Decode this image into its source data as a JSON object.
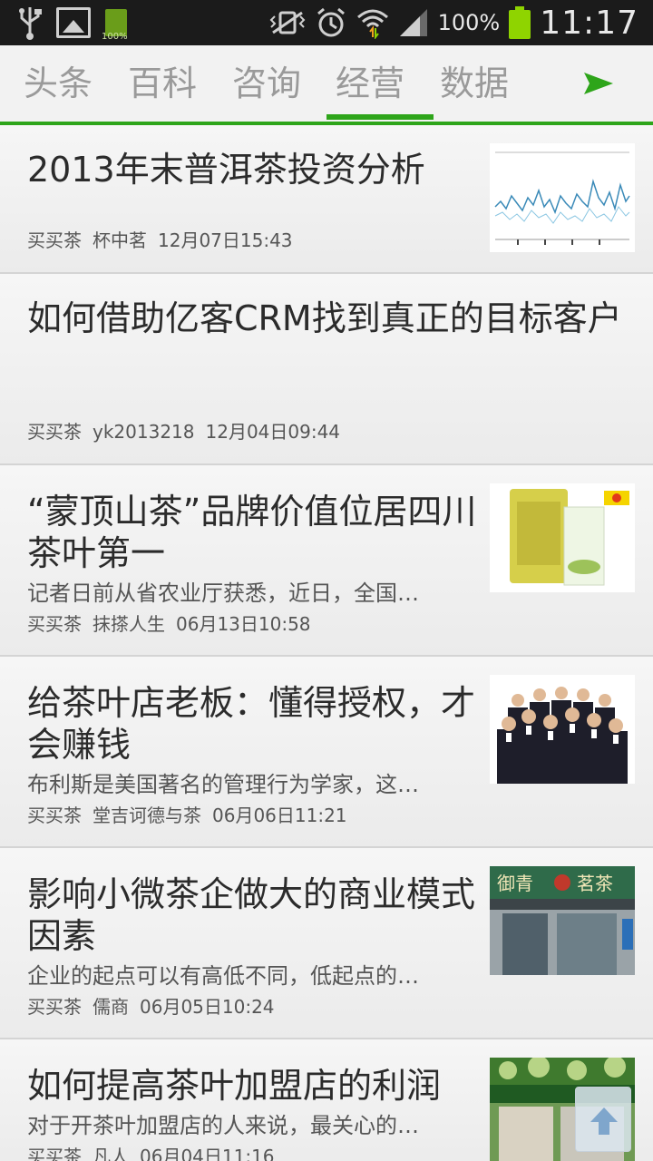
{
  "status_bar": {
    "battery_small_label": "100%",
    "battery_percent": "100%",
    "time": "11:17"
  },
  "tabs": [
    {
      "label": "头条"
    },
    {
      "label": "百科"
    },
    {
      "label": "咨询"
    },
    {
      "label": "经营",
      "active": true
    },
    {
      "label": "数据"
    }
  ],
  "articles": [
    {
      "title": "2013年末普洱茶投资分析",
      "summary": "",
      "source": "买买茶",
      "author": "杯中茗",
      "time": "12月07日15:43",
      "thumb": "chart-thumbnail"
    },
    {
      "title": "如何借助亿客CRM找到真正的目标客户",
      "summary": "",
      "source": "买买茶",
      "author": "yk2013218",
      "time": "12月04日09:44",
      "thumb": ""
    },
    {
      "title": "“蒙顶山茶”品牌价值位居四川茶叶第一",
      "summary": "记者日前从省农业厅获悉，近日，全国…",
      "source": "买买茶",
      "author": "抹搽人生",
      "time": "06月13日10:58",
      "thumb": "tea-package-thumbnail"
    },
    {
      "title": "给茶叶店老板：懂得授权，才会赚钱",
      "summary": "布利斯是美国著名的管理行为学家，这…",
      "source": "买买茶",
      "author": "堂吉诃德与茶",
      "time": "06月06日11:21",
      "thumb": "group-photo-thumbnail"
    },
    {
      "title": "影响小微茶企做大的商业模式因素",
      "summary": "企业的起点可以有高低不同，低起点的…",
      "source": "买买茶",
      "author": "儒商",
      "time": "06月05日10:24",
      "thumb": "storefront-thumbnail"
    },
    {
      "title": "如何提高茶叶加盟店的利润",
      "summary": "对于开茶叶加盟店的人来说，最关心的…",
      "source": "买买茶",
      "author": "凡人",
      "time": "06月04日11:16",
      "thumb": "shop-thumbnail"
    }
  ],
  "thumb_sign_1": "御青",
  "thumb_sign_2": "茗茶",
  "colors": {
    "accent": "#2ea51a",
    "status_bar": "#1b1b1b",
    "battery": "#8fd400"
  }
}
